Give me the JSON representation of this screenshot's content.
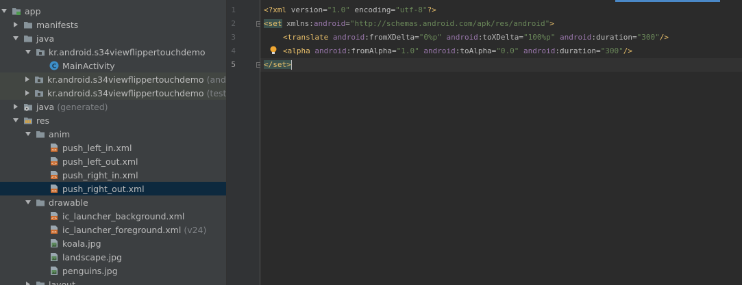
{
  "project_tree": {
    "items": [
      {
        "label": "app",
        "suffix": "",
        "icon": "module-folder-icon"
      },
      {
        "label": "manifests",
        "suffix": "",
        "icon": "folder-icon"
      },
      {
        "label": "java",
        "suffix": "",
        "icon": "folder-icon"
      },
      {
        "label": "kr.android.s34viewflippertouchdemo",
        "suffix": "",
        "icon": "package-icon"
      },
      {
        "label": "MainActivity",
        "suffix": "",
        "icon": "class-icon"
      },
      {
        "label": "kr.android.s34viewflippertouchdemo",
        "suffix": "(androidTest)",
        "icon": "package-icon"
      },
      {
        "label": "kr.android.s34viewflippertouchdemo",
        "suffix": "(test)",
        "icon": "package-icon"
      },
      {
        "label": "java",
        "suffix": "(generated)",
        "icon": "generated-folder-icon"
      },
      {
        "label": "res",
        "suffix": "",
        "icon": "res-folder-icon"
      },
      {
        "label": "anim",
        "suffix": "",
        "icon": "folder-icon"
      },
      {
        "label": "push_left_in.xml",
        "suffix": "",
        "icon": "xml-file-icon"
      },
      {
        "label": "push_left_out.xml",
        "suffix": "",
        "icon": "xml-file-icon"
      },
      {
        "label": "push_right_in.xml",
        "suffix": "",
        "icon": "xml-file-icon"
      },
      {
        "label": "push_right_out.xml",
        "suffix": "",
        "icon": "xml-file-icon"
      },
      {
        "label": "drawable",
        "suffix": "",
        "icon": "folder-icon"
      },
      {
        "label": "ic_launcher_background.xml",
        "suffix": "",
        "icon": "xml-file-icon"
      },
      {
        "label": "ic_launcher_foreground.xml",
        "suffix": "(v24)",
        "icon": "xml-file-icon"
      },
      {
        "label": "koala.jpg",
        "suffix": "",
        "icon": "image-file-icon"
      },
      {
        "label": "landscape.jpg",
        "suffix": "",
        "icon": "image-file-icon"
      },
      {
        "label": "penguins.jpg",
        "suffix": "",
        "icon": "image-file-icon"
      },
      {
        "label": "layout",
        "suffix": "",
        "icon": "folder-icon"
      }
    ]
  },
  "editor": {
    "line_numbers": [
      "1",
      "2",
      "3",
      "4",
      "5"
    ],
    "lines": {
      "l1": {
        "pi_open": "<?xml",
        "a1": " version=",
        "v1": "\"1.0\"",
        "a2": " encoding=",
        "v2": "\"utf-8\"",
        "pi_close": "?>"
      },
      "l2": {
        "open": "<set",
        "attr": " xmlns:",
        "ns": "android",
        "eq": "=",
        "val": "\"http://schemas.android.com/apk/res/android\"",
        "close": ">"
      },
      "l3": {
        "open": "<translate",
        "ns1": " android",
        "a1": ":fromXDelta=",
        "v1": "\"0%p\"",
        "ns2": " android",
        "a2": ":toXDelta=",
        "v2": "\"100%p\"",
        "ns3": " android",
        "a3": ":duration=",
        "v3": "\"300\"",
        "close": "/>"
      },
      "l4": {
        "open": "<alpha",
        "ns1": " android",
        "a1": ":fromAlpha=",
        "v1": "\"1.0\"",
        "ns2": " android",
        "a2": ":toAlpha=",
        "v2": "\"0.0\"",
        "ns3": " android",
        "a3": ":duration=",
        "v3": "\"300\"",
        "close": "/>"
      },
      "l5": {
        "close_tag": "</set>"
      }
    }
  },
  "colors": {
    "tree_bg": "#3c3f41",
    "selected_row": "#0d293e",
    "editor_bg": "#2b2b2b",
    "xml_tag": "#e8bf6a",
    "xml_value": "#6a8759",
    "namespace": "#9876aa",
    "tab_indicator": "#4a88c7"
  }
}
